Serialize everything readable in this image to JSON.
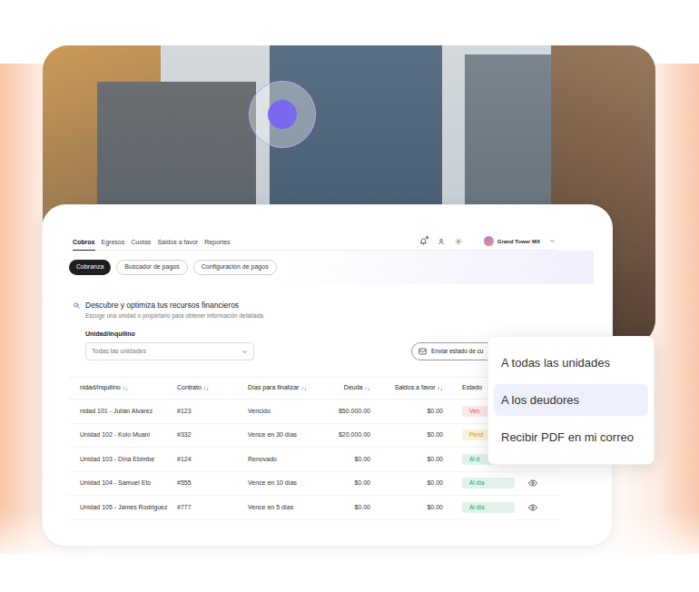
{
  "nav": {
    "tabs": [
      {
        "label": "Cobros",
        "selected": true
      },
      {
        "label": "Egresos",
        "selected": false
      },
      {
        "label": "Cuotas",
        "selected": false
      },
      {
        "label": "Saldos a favor",
        "selected": false
      },
      {
        "label": "Reportes",
        "selected": false
      }
    ],
    "notifications": {
      "unread": true
    },
    "account": {
      "name": "Grand Tower MX"
    }
  },
  "subtabs": [
    {
      "label": "Cobranza",
      "selected": true
    },
    {
      "label": "Buscador de pagos",
      "selected": false
    },
    {
      "label": "Configuración de pagos",
      "selected": false
    }
  ],
  "filter": {
    "title": "Descubre y optimiza tus recursos financieros",
    "subtitle": "Escoge una unidad o propietario para obtener información detallada.",
    "label": "Unidad/inquilino",
    "value": "Todas las unidades"
  },
  "send_button": {
    "label": "Enviar estado de cu"
  },
  "table": {
    "sort_icon": "↑↓",
    "columns": [
      {
        "label": "nidad/inquilino",
        "sortable": true
      },
      {
        "label": "Contrato",
        "sortable": true
      },
      {
        "label": "Días para finalizar",
        "sortable": true
      },
      {
        "label": "Deuda",
        "sortable": true
      },
      {
        "label": "Saldos a favor",
        "sortable": true
      },
      {
        "label": "Estado",
        "sortable": false
      }
    ],
    "rows": [
      {
        "unit": "nidad 101 - Julián Alvarez",
        "contract": "#123",
        "days": "Vencido",
        "debt": "$50.000.00",
        "credit": "$0.00",
        "status": "Ven",
        "color": "#e0555a"
      },
      {
        "unit": "Unidad 102 - Kolo Muani",
        "contract": "#332",
        "days": "Vence en 30 días",
        "debt": "$20.000.00",
        "credit": "$0.00",
        "status": "Pend",
        "color": "#d49a00"
      },
      {
        "unit": "Unidad 103 - Dina Ebimbe",
        "contract": "#124",
        "days": "Renovado",
        "debt": "$0.00",
        "credit": "$0.00",
        "status": "Al d",
        "color": "#2e9e5b"
      },
      {
        "unit": "Unidad 104 - Samuel Eto",
        "contract": "#555",
        "days": "Vence en 10 días",
        "debt": "$0.00",
        "credit": "$0.00",
        "status": "Al día",
        "color": "#2e9e5b"
      },
      {
        "unit": "Unidad 105 - James Rodriguez",
        "contract": "#777",
        "days": "Vence en 5 días",
        "debt": "$0.00",
        "credit": "$0.00",
        "status": "Al día",
        "color": "#2e9e5b"
      }
    ]
  },
  "menu": {
    "items": [
      {
        "label": "A todas las unidades",
        "selected": false
      },
      {
        "label": "A los deudores",
        "selected": true
      },
      {
        "label": "Recibir PDF en mi correo",
        "selected": false
      }
    ]
  }
}
